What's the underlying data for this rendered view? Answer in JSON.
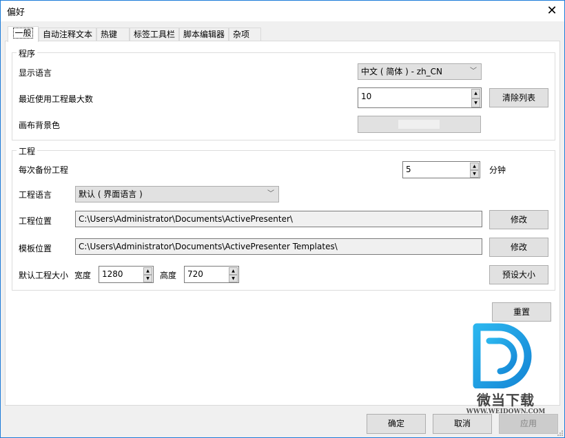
{
  "window": {
    "title": "偏好",
    "close_icon": "close-icon"
  },
  "tabs": [
    {
      "label": "一般",
      "active": true
    },
    {
      "label": "自动注释文本",
      "active": false
    },
    {
      "label": "热键",
      "active": false
    },
    {
      "label": "标签工具栏",
      "active": false
    },
    {
      "label": "脚本编辑器",
      "active": false
    },
    {
      "label": "杂项",
      "active": false
    }
  ],
  "program": {
    "title": "程序",
    "display_language_label": "显示语言",
    "display_language_value": "中文 ( 简体 )  - zh_CN",
    "recent_projects_label": "最近使用工程最大数",
    "recent_projects_value": "10",
    "clear_list_button": "清除列表",
    "canvas_bg_label": "画布背景色",
    "canvas_bg_color": "#f0f0f0"
  },
  "project": {
    "title": "工程",
    "backup_label": "每次备份工程",
    "backup_value": "5",
    "backup_unit": "分钟",
    "language_label": "工程语言",
    "language_value": "默认 ( 界面语言 )",
    "location_label": "工程位置",
    "location_value": "C:\\Users\\Administrator\\Documents\\ActivePresenter\\",
    "location_button": "修改",
    "template_label": "模板位置",
    "template_value": "C:\\Users\\Administrator\\Documents\\ActivePresenter Templates\\",
    "template_button": "修改",
    "default_size_label": "默认工程大小",
    "width_label": "宽度",
    "width_value": "1280",
    "height_label": "高度",
    "height_value": "720",
    "preset_size_button": "预设大小"
  },
  "reset_button": "重置",
  "footer": {
    "ok_button": "确定",
    "cancel_button": "取消",
    "apply_button": "应用"
  },
  "watermark": {
    "brand": "微当下载",
    "url": "WWW.WEIDOWN.COM",
    "color": "#1a9be0"
  }
}
